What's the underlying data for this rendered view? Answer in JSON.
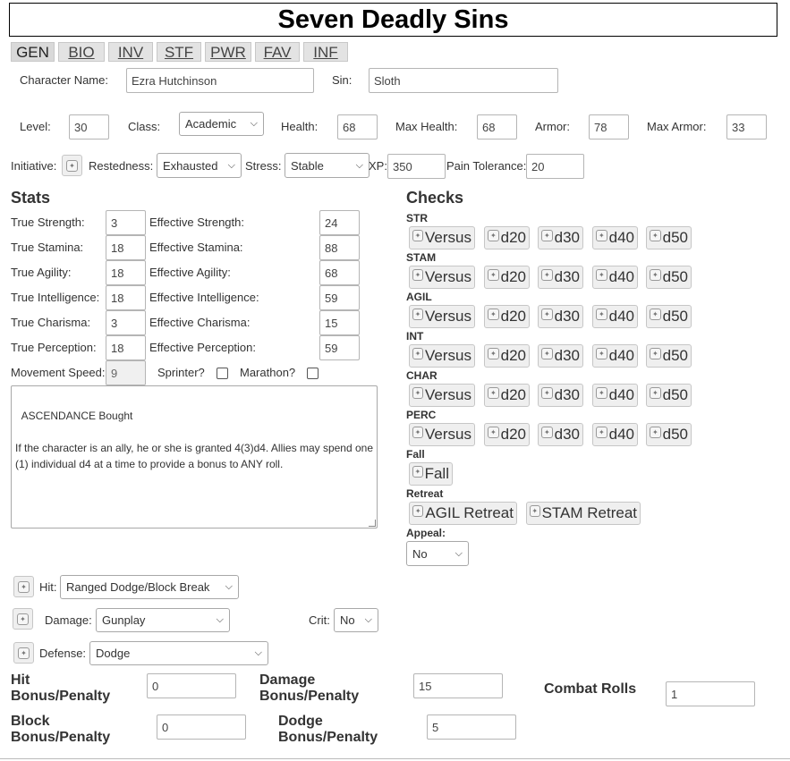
{
  "title": "Seven Deadly Sins",
  "tabs": [
    "GEN",
    "BIO",
    "INV",
    "STF",
    "PWR",
    "FAV",
    "INF"
  ],
  "character": {
    "name_label": "Character Name:",
    "name_value": "Ezra Hutchinson",
    "sin_label": "Sin:",
    "sin_value": "Sloth"
  },
  "row2": {
    "level_label": "Level:",
    "level_value": "30",
    "class_label": "Class:",
    "class_value": "Academic",
    "health_label": "Health:",
    "health_value": "68",
    "maxhealth_label": "Max Health:",
    "maxhealth_value": "68",
    "armor_label": "Armor:",
    "armor_value": "78",
    "maxarmor_label": "Max Armor:",
    "maxarmor_value": "33"
  },
  "row3": {
    "initiative_label": "Initiative:",
    "restedness_label": "Restedness:",
    "restedness_value": "Exhausted",
    "stress_label": "Stress:",
    "stress_value": "Stable",
    "xp_label": "XP:",
    "xp_value": "350",
    "pain_label": "Pain Tolerance:",
    "pain_value": "20"
  },
  "stats": {
    "heading": "Stats",
    "rows": [
      {
        "true_label": "True Strength:",
        "true_value": "3",
        "eff_label": "Effective Strength:",
        "eff_value": "24"
      },
      {
        "true_label": "True Stamina:",
        "true_value": "18",
        "eff_label": "Effective Stamina:",
        "eff_value": "88"
      },
      {
        "true_label": "True Agility:",
        "true_value": "18",
        "eff_label": "Effective Agility:",
        "eff_value": "68"
      },
      {
        "true_label": "True Intelligence:",
        "true_value": "18",
        "eff_label": "Effective Intelligence:",
        "eff_value": "59"
      },
      {
        "true_label": "True Charisma:",
        "true_value": "3",
        "eff_label": "Effective Charisma:",
        "eff_value": "15"
      },
      {
        "true_label": "True Perception:",
        "true_value": "18",
        "eff_label": "Effective Perception:",
        "eff_value": "59"
      }
    ],
    "movement_label": "Movement Speed:",
    "movement_value": "9",
    "sprinter_label": "Sprinter?",
    "marathon_label": "Marathon?",
    "notes": "ASCENDANCE Bought\n\nIf the character is an ally, he or she is granted 4(3)d4. Allies may spend one (1) individual d4 at a time to provide a bonus to ANY roll."
  },
  "checks": {
    "heading": "Checks",
    "groups": [
      {
        "label": "STR",
        "buttons": [
          "Versus",
          "d20",
          "d30",
          "d40",
          "d50"
        ]
      },
      {
        "label": "STAM",
        "buttons": [
          "Versus",
          "d20",
          "d30",
          "d40",
          "d50"
        ]
      },
      {
        "label": "AGIL",
        "buttons": [
          "Versus",
          "d20",
          "d30",
          "d40",
          "d50"
        ]
      },
      {
        "label": "INT",
        "buttons": [
          "Versus",
          "d20",
          "d30",
          "d40",
          "d50"
        ]
      },
      {
        "label": "CHAR",
        "buttons": [
          "Versus",
          "d20",
          "d30",
          "d40",
          "d50"
        ]
      },
      {
        "label": "PERC",
        "buttons": [
          "Versus",
          "d20",
          "d30",
          "d40",
          "d50"
        ]
      }
    ],
    "fall_label": "Fall",
    "fall_button": "Fall",
    "retreat_label": "Retreat",
    "retreat_agil": "AGIL Retreat",
    "retreat_stam": "STAM Retreat",
    "appeal_label": "Appeal:",
    "appeal_value": "No"
  },
  "combat": {
    "hit_label": "Hit:",
    "hit_value": "Ranged Dodge/Block Break",
    "damage_label": "Damage:",
    "damage_value": "Gunplay",
    "crit_label": "Crit:",
    "crit_value": "No",
    "defense_label": "Defense:",
    "defense_value": "Dodge",
    "hit_bonus_l1": "Hit",
    "hit_bonus_l2": "Bonus/Penalty",
    "hit_bonus_value": "0",
    "damage_bonus_l1": "Damage",
    "damage_bonus_l2": "Bonus/Penalty",
    "damage_bonus_value": "15",
    "combat_rolls_label": "Combat Rolls",
    "combat_rolls_value": "1",
    "block_bonus_l1": "Block",
    "block_bonus_l2": "Bonus/Penalty",
    "block_bonus_value": "0",
    "dodge_bonus_l1": "Dodge",
    "dodge_bonus_l2": "Bonus/Penalty",
    "dodge_bonus_value": "5"
  }
}
